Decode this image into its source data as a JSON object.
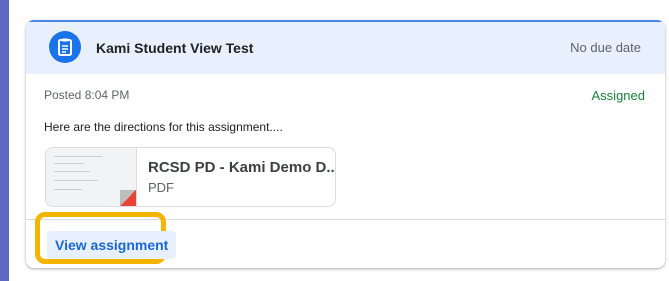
{
  "card": {
    "title": "Kami Student View Test",
    "due": "No due date",
    "posted": "Posted 8:04 PM",
    "status": "Assigned",
    "directions": "Here are the directions for this assignment....",
    "attachment": {
      "title": "RCSD PD - Kami Demo D...",
      "type": "PDF",
      "icon": "pdf-thumbnail-icon"
    },
    "action_label": "View assignment",
    "icon": "assignment-icon"
  },
  "colors": {
    "frame": "#5c6bc0",
    "header_bg": "#e8f0fe",
    "accent": "#1a73e8",
    "status_green": "#188038",
    "highlight": "#f4b400"
  }
}
